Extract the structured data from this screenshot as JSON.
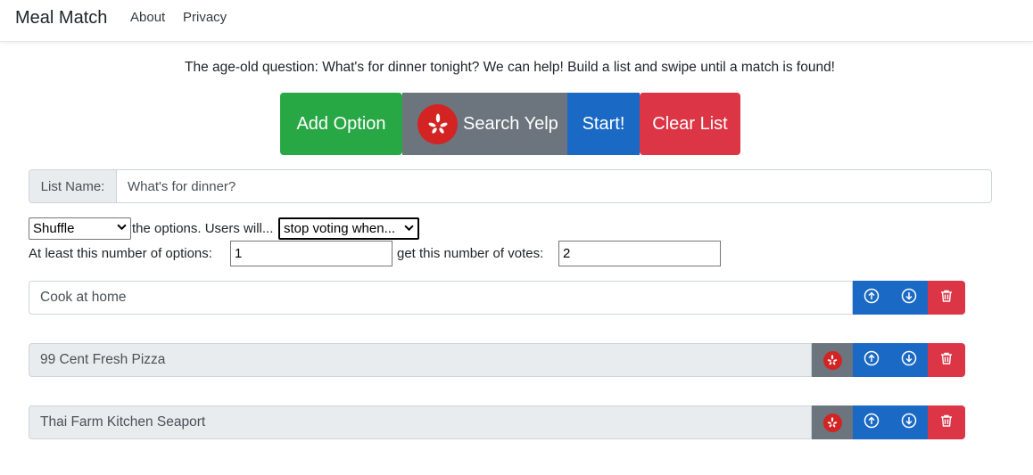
{
  "nav": {
    "brand": "Meal Match",
    "links": [
      "About",
      "Privacy"
    ]
  },
  "intro": "The age-old question: What's for dinner tonight? We can help! Build a list and swipe until a match is found!",
  "actions": {
    "add_option": "Add Option",
    "search_yelp": "Search Yelp",
    "start": "Start!",
    "clear_list": "Clear List"
  },
  "list_name": {
    "label": "List Name:",
    "value": "What's for dinner?"
  },
  "settings": {
    "order_select": "Shuffle",
    "text_middle": "the options. Users will...",
    "mode_select": "stop voting when...",
    "min_options_label": "At least this number of options:",
    "min_options_value": "1",
    "votes_label": "get this number of votes:",
    "votes_value": "2"
  },
  "options": [
    {
      "name": "Cook at home",
      "from_yelp": false
    },
    {
      "name": "99 Cent Fresh Pizza",
      "from_yelp": true
    },
    {
      "name": "Thai Farm Kitchen Seaport",
      "from_yelp": true
    }
  ],
  "colors": {
    "green": "#28a745",
    "gray": "#6c757d",
    "blue": "#1a69c4",
    "red": "#dc3545",
    "yelp": "#d32323"
  }
}
